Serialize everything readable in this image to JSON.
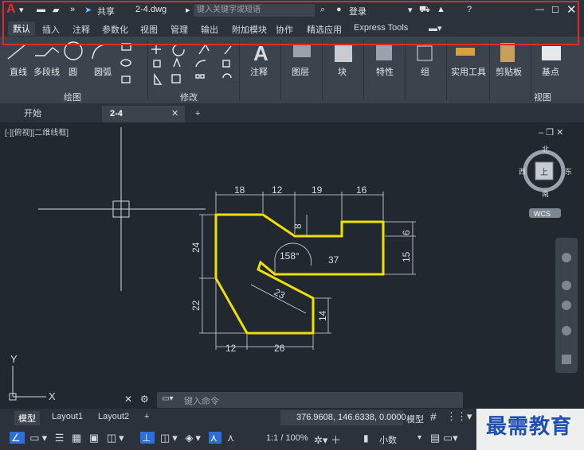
{
  "titlebar": {
    "app_letter": "A",
    "share": "共享",
    "filename": "2-4.dwg",
    "search_placeholder": "键入关键字或短语",
    "login": "登录"
  },
  "ribbon_tabs": [
    "默认",
    "插入",
    "注释",
    "参数化",
    "视图",
    "管理",
    "输出",
    "附加模块",
    "协作",
    "精选应用",
    "Express Tools"
  ],
  "draw_tools": [
    "直线",
    "多段线",
    "圆",
    "圆弧"
  ],
  "panels": {
    "draw": "绘图",
    "modify": "修改",
    "annotation": "注释",
    "layers": "图层",
    "block": "块",
    "properties": "特性",
    "groups": "组",
    "utilities": "实用工具",
    "clipboard": "剪贴板",
    "base": "基点",
    "view": "视图"
  },
  "doc_tabs": [
    "开始",
    "2-4"
  ],
  "viewport_label": "[-][俯视][二维线框]",
  "viewcube": {
    "north": "北",
    "south": "南",
    "east": "东",
    "west": "西",
    "top": "上",
    "wcs": "WCS"
  },
  "dimensions": {
    "top": [
      "18",
      "12",
      "19",
      "16"
    ],
    "right": [
      "6",
      "15"
    ],
    "inner_8": "8",
    "angle": "158°",
    "inner_37": "37",
    "slant_23": "23",
    "left": [
      "24",
      "22"
    ],
    "right_14": "14",
    "bottom": [
      "12",
      "26"
    ]
  },
  "ucs": {
    "x": "X",
    "y": "Y"
  },
  "command": {
    "placeholder": "键入命令"
  },
  "layouts": [
    "模型",
    "Layout1",
    "Layout2"
  ],
  "status": {
    "coords": "376.9608, 146.6338, 0.0000",
    "model": "模型",
    "scale": "1:1 / 100%",
    "units": "小数"
  },
  "watermark": "最需教育",
  "colors": {
    "accent_red": "#e02a2a",
    "outline": "#f0e000",
    "background": "#212830"
  }
}
